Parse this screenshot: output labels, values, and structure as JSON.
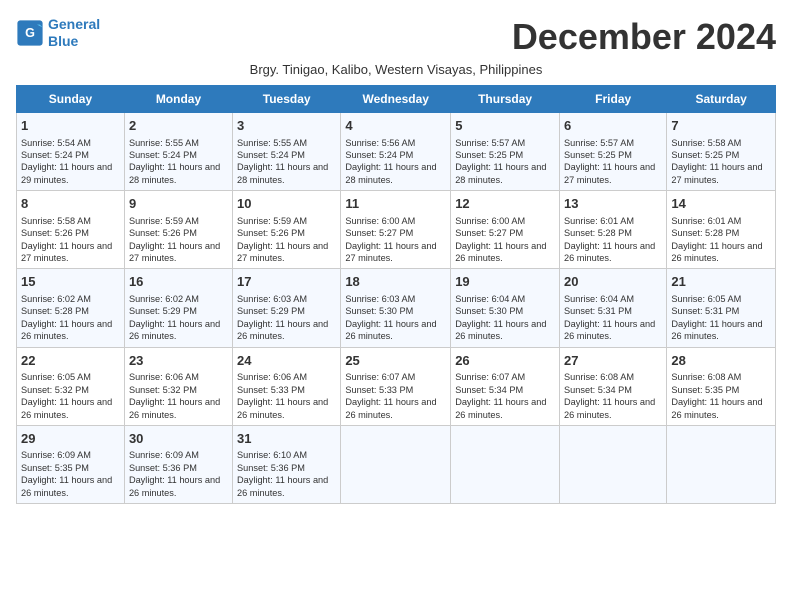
{
  "logo": {
    "line1": "General",
    "line2": "Blue"
  },
  "title": "December 2024",
  "subtitle": "Brgy. Tinigao, Kalibo, Western Visayas, Philippines",
  "days_header": [
    "Sunday",
    "Monday",
    "Tuesday",
    "Wednesday",
    "Thursday",
    "Friday",
    "Saturday"
  ],
  "weeks": [
    [
      {
        "day": "1",
        "info": "Sunrise: 5:54 AM\nSunset: 5:24 PM\nDaylight: 11 hours and 29 minutes."
      },
      {
        "day": "2",
        "info": "Sunrise: 5:55 AM\nSunset: 5:24 PM\nDaylight: 11 hours and 28 minutes."
      },
      {
        "day": "3",
        "info": "Sunrise: 5:55 AM\nSunset: 5:24 PM\nDaylight: 11 hours and 28 minutes."
      },
      {
        "day": "4",
        "info": "Sunrise: 5:56 AM\nSunset: 5:24 PM\nDaylight: 11 hours and 28 minutes."
      },
      {
        "day": "5",
        "info": "Sunrise: 5:57 AM\nSunset: 5:25 PM\nDaylight: 11 hours and 28 minutes."
      },
      {
        "day": "6",
        "info": "Sunrise: 5:57 AM\nSunset: 5:25 PM\nDaylight: 11 hours and 27 minutes."
      },
      {
        "day": "7",
        "info": "Sunrise: 5:58 AM\nSunset: 5:25 PM\nDaylight: 11 hours and 27 minutes."
      }
    ],
    [
      {
        "day": "8",
        "info": "Sunrise: 5:58 AM\nSunset: 5:26 PM\nDaylight: 11 hours and 27 minutes."
      },
      {
        "day": "9",
        "info": "Sunrise: 5:59 AM\nSunset: 5:26 PM\nDaylight: 11 hours and 27 minutes."
      },
      {
        "day": "10",
        "info": "Sunrise: 5:59 AM\nSunset: 5:26 PM\nDaylight: 11 hours and 27 minutes."
      },
      {
        "day": "11",
        "info": "Sunrise: 6:00 AM\nSunset: 5:27 PM\nDaylight: 11 hours and 27 minutes."
      },
      {
        "day": "12",
        "info": "Sunrise: 6:00 AM\nSunset: 5:27 PM\nDaylight: 11 hours and 26 minutes."
      },
      {
        "day": "13",
        "info": "Sunrise: 6:01 AM\nSunset: 5:28 PM\nDaylight: 11 hours and 26 minutes."
      },
      {
        "day": "14",
        "info": "Sunrise: 6:01 AM\nSunset: 5:28 PM\nDaylight: 11 hours and 26 minutes."
      }
    ],
    [
      {
        "day": "15",
        "info": "Sunrise: 6:02 AM\nSunset: 5:28 PM\nDaylight: 11 hours and 26 minutes."
      },
      {
        "day": "16",
        "info": "Sunrise: 6:02 AM\nSunset: 5:29 PM\nDaylight: 11 hours and 26 minutes."
      },
      {
        "day": "17",
        "info": "Sunrise: 6:03 AM\nSunset: 5:29 PM\nDaylight: 11 hours and 26 minutes."
      },
      {
        "day": "18",
        "info": "Sunrise: 6:03 AM\nSunset: 5:30 PM\nDaylight: 11 hours and 26 minutes."
      },
      {
        "day": "19",
        "info": "Sunrise: 6:04 AM\nSunset: 5:30 PM\nDaylight: 11 hours and 26 minutes."
      },
      {
        "day": "20",
        "info": "Sunrise: 6:04 AM\nSunset: 5:31 PM\nDaylight: 11 hours and 26 minutes."
      },
      {
        "day": "21",
        "info": "Sunrise: 6:05 AM\nSunset: 5:31 PM\nDaylight: 11 hours and 26 minutes."
      }
    ],
    [
      {
        "day": "22",
        "info": "Sunrise: 6:05 AM\nSunset: 5:32 PM\nDaylight: 11 hours and 26 minutes."
      },
      {
        "day": "23",
        "info": "Sunrise: 6:06 AM\nSunset: 5:32 PM\nDaylight: 11 hours and 26 minutes."
      },
      {
        "day": "24",
        "info": "Sunrise: 6:06 AM\nSunset: 5:33 PM\nDaylight: 11 hours and 26 minutes."
      },
      {
        "day": "25",
        "info": "Sunrise: 6:07 AM\nSunset: 5:33 PM\nDaylight: 11 hours and 26 minutes."
      },
      {
        "day": "26",
        "info": "Sunrise: 6:07 AM\nSunset: 5:34 PM\nDaylight: 11 hours and 26 minutes."
      },
      {
        "day": "27",
        "info": "Sunrise: 6:08 AM\nSunset: 5:34 PM\nDaylight: 11 hours and 26 minutes."
      },
      {
        "day": "28",
        "info": "Sunrise: 6:08 AM\nSunset: 5:35 PM\nDaylight: 11 hours and 26 minutes."
      }
    ],
    [
      {
        "day": "29",
        "info": "Sunrise: 6:09 AM\nSunset: 5:35 PM\nDaylight: 11 hours and 26 minutes."
      },
      {
        "day": "30",
        "info": "Sunrise: 6:09 AM\nSunset: 5:36 PM\nDaylight: 11 hours and 26 minutes."
      },
      {
        "day": "31",
        "info": "Sunrise: 6:10 AM\nSunset: 5:36 PM\nDaylight: 11 hours and 26 minutes."
      },
      {
        "day": "",
        "info": ""
      },
      {
        "day": "",
        "info": ""
      },
      {
        "day": "",
        "info": ""
      },
      {
        "day": "",
        "info": ""
      }
    ]
  ]
}
